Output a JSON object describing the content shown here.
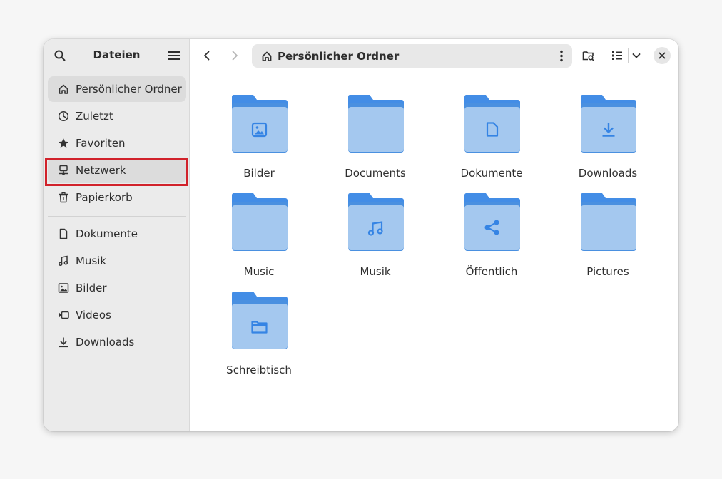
{
  "sidebar": {
    "title": "Dateien",
    "places": [
      {
        "label": "Persönlicher Ordner",
        "icon": "home-icon",
        "active": true
      },
      {
        "label": "Zuletzt",
        "icon": "clock-icon"
      },
      {
        "label": "Favoriten",
        "icon": "star-icon"
      },
      {
        "label": "Netzwerk",
        "icon": "network-icon",
        "highlighted": true
      },
      {
        "label": "Papierkorb",
        "icon": "trash-icon"
      }
    ],
    "bookmarks": [
      {
        "label": "Dokumente",
        "icon": "document-icon"
      },
      {
        "label": "Musik",
        "icon": "music-icon"
      },
      {
        "label": "Bilder",
        "icon": "image-icon"
      },
      {
        "label": "Videos",
        "icon": "video-icon"
      },
      {
        "label": "Downloads",
        "icon": "download-icon"
      }
    ]
  },
  "header": {
    "location": "Persönlicher Ordner"
  },
  "files": [
    {
      "name": "Bilder",
      "emblem": "image-icon"
    },
    {
      "name": "Documents",
      "emblem": ""
    },
    {
      "name": "Dokumente",
      "emblem": "document-icon"
    },
    {
      "name": "Downloads",
      "emblem": "download-icon"
    },
    {
      "name": "Music",
      "emblem": ""
    },
    {
      "name": "Musik",
      "emblem": "music-icon"
    },
    {
      "name": "Öffentlich",
      "emblem": "share-icon"
    },
    {
      "name": "Pictures",
      "emblem": ""
    },
    {
      "name": "Schreibtisch",
      "emblem": "desktop-folder-icon"
    }
  ],
  "colors": {
    "folder_back": "#438de6",
    "folder_front": "#a4c8ef",
    "emblem": "#3584e4",
    "highlight": "#d1222b"
  }
}
